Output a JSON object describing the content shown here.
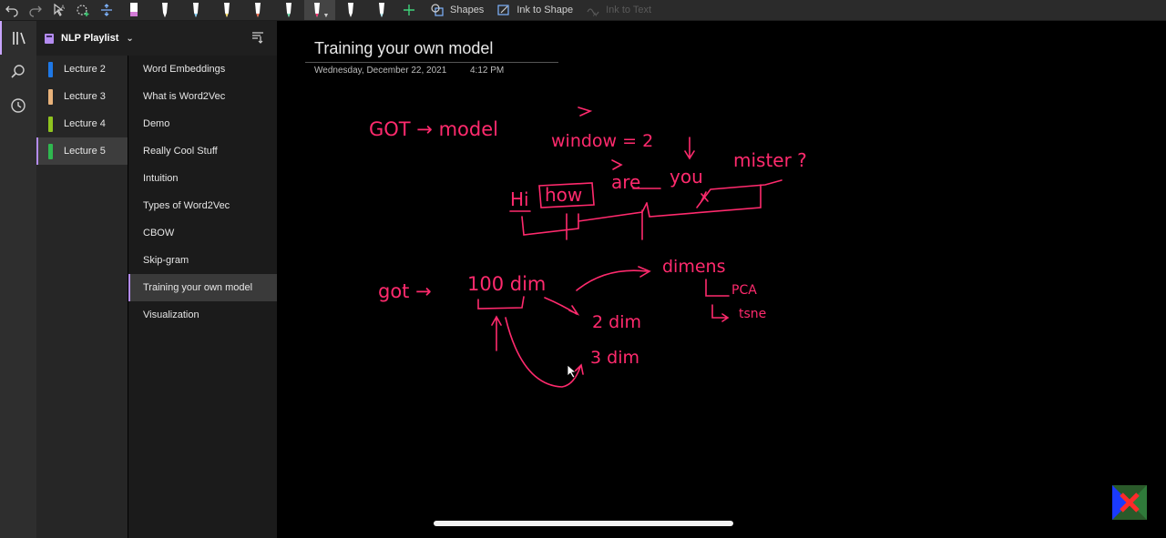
{
  "toolbar": {
    "shapes_label": "Shapes",
    "ink_to_shape_label": "Ink to Shape",
    "ink_to_text_label": "Ink to Text",
    "pens": [
      {
        "name": "pen-1",
        "color": "#d37bd6"
      },
      {
        "name": "pen-2",
        "color": "#ffffff"
      },
      {
        "name": "pen-3",
        "color": "#7fd3ff"
      },
      {
        "name": "pen-4",
        "color": "#ffe066"
      },
      {
        "name": "pen-5",
        "color": "#ff6b4a"
      },
      {
        "name": "pen-6",
        "color": "#6fe3b0"
      },
      {
        "name": "pen-7",
        "color": "#ff2a6d"
      },
      {
        "name": "pen-8",
        "color": "#ffffff"
      },
      {
        "name": "pen-9",
        "color": "#b9f3ff"
      }
    ]
  },
  "notebook": {
    "name": "NLP Playlist",
    "accent_color": "#b48cf0"
  },
  "sections": [
    {
      "label": "Lecture 2",
      "color": "#1e78e6"
    },
    {
      "label": "Lecture 3",
      "color": "#e8b27a"
    },
    {
      "label": "Lecture 4",
      "color": "#8fc31f"
    },
    {
      "label": "Lecture 5",
      "color": "#2fb84f"
    }
  ],
  "pages": [
    {
      "label": "Word Embeddings"
    },
    {
      "label": "What is Word2Vec"
    },
    {
      "label": "Demo"
    },
    {
      "label": "Really Cool Stuff"
    },
    {
      "label": "Intuition"
    },
    {
      "label": "Types of Word2Vec"
    },
    {
      "label": "CBOW"
    },
    {
      "label": "Skip-gram"
    },
    {
      "label": "Training your own model"
    },
    {
      "label": "Visualization"
    }
  ],
  "page": {
    "title": "Training your own model",
    "date": "Wednesday, December 22, 2021",
    "time": "4:12 PM",
    "ink_color": "#ff2a6d",
    "ink": {
      "got_model": "GOT → model",
      "window": "window = 2",
      "sentence_hi": "Hi",
      "sentence_how": "how",
      "sentence_are": "are",
      "sentence_you": "you",
      "sentence_mister": "mister ?",
      "got2": "got →",
      "hundred_dim": "100 dim",
      "two_dim": "2 dim",
      "three_dim": "3 dim",
      "dimens": "dimens",
      "pca": "PCA",
      "tsne": "tsne"
    }
  }
}
